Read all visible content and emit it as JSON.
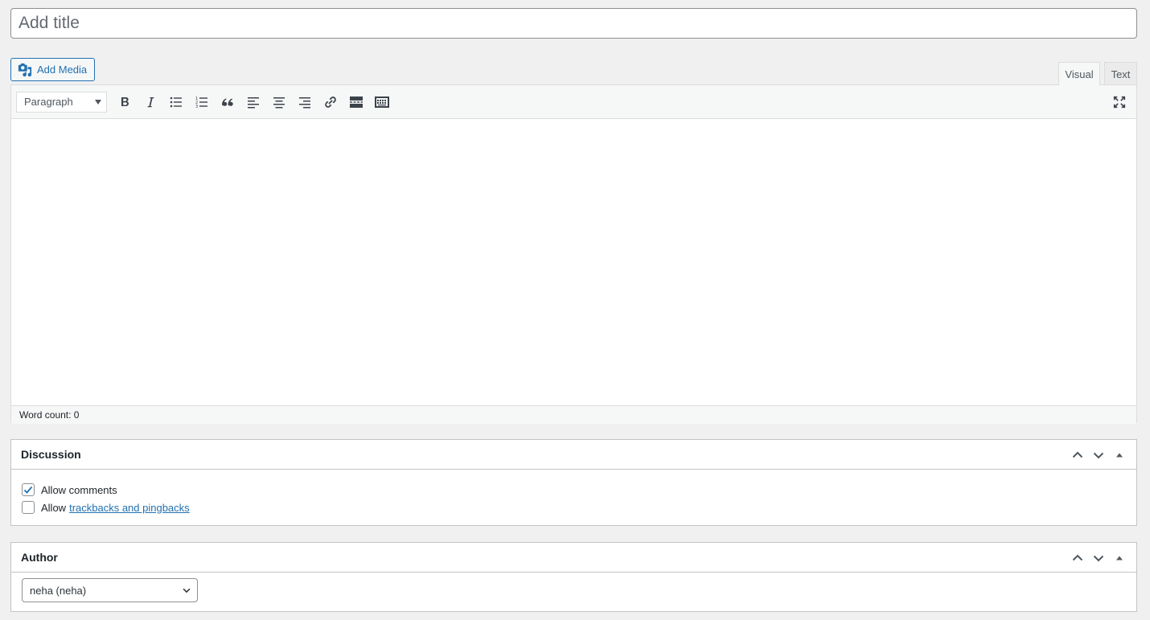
{
  "title": {
    "placeholder": "Add title",
    "value": ""
  },
  "media": {
    "add_label": "Add Media"
  },
  "tabs": {
    "visual": "Visual",
    "text": "Text"
  },
  "toolbar": {
    "format": "Paragraph",
    "buttons": [
      "bold",
      "italic",
      "bulleted-list",
      "numbered-list",
      "blockquote",
      "align-left",
      "align-center",
      "align-right",
      "insert-link",
      "read-more",
      "toolbar-toggle"
    ]
  },
  "status": {
    "word_count": "Word count: 0"
  },
  "discussion": {
    "title": "Discussion",
    "allow_comments": {
      "label": "Allow comments",
      "checked": true
    },
    "allow_trackbacks": {
      "label": "Allow",
      "link": "trackbacks and pingbacks",
      "checked": false
    }
  },
  "author": {
    "title": "Author",
    "selected": "neha (neha)"
  },
  "colors": {
    "accent": "#2271b1",
    "text": "#1d2327",
    "background": "#f0f0f1",
    "border": "#c3c4c7"
  }
}
